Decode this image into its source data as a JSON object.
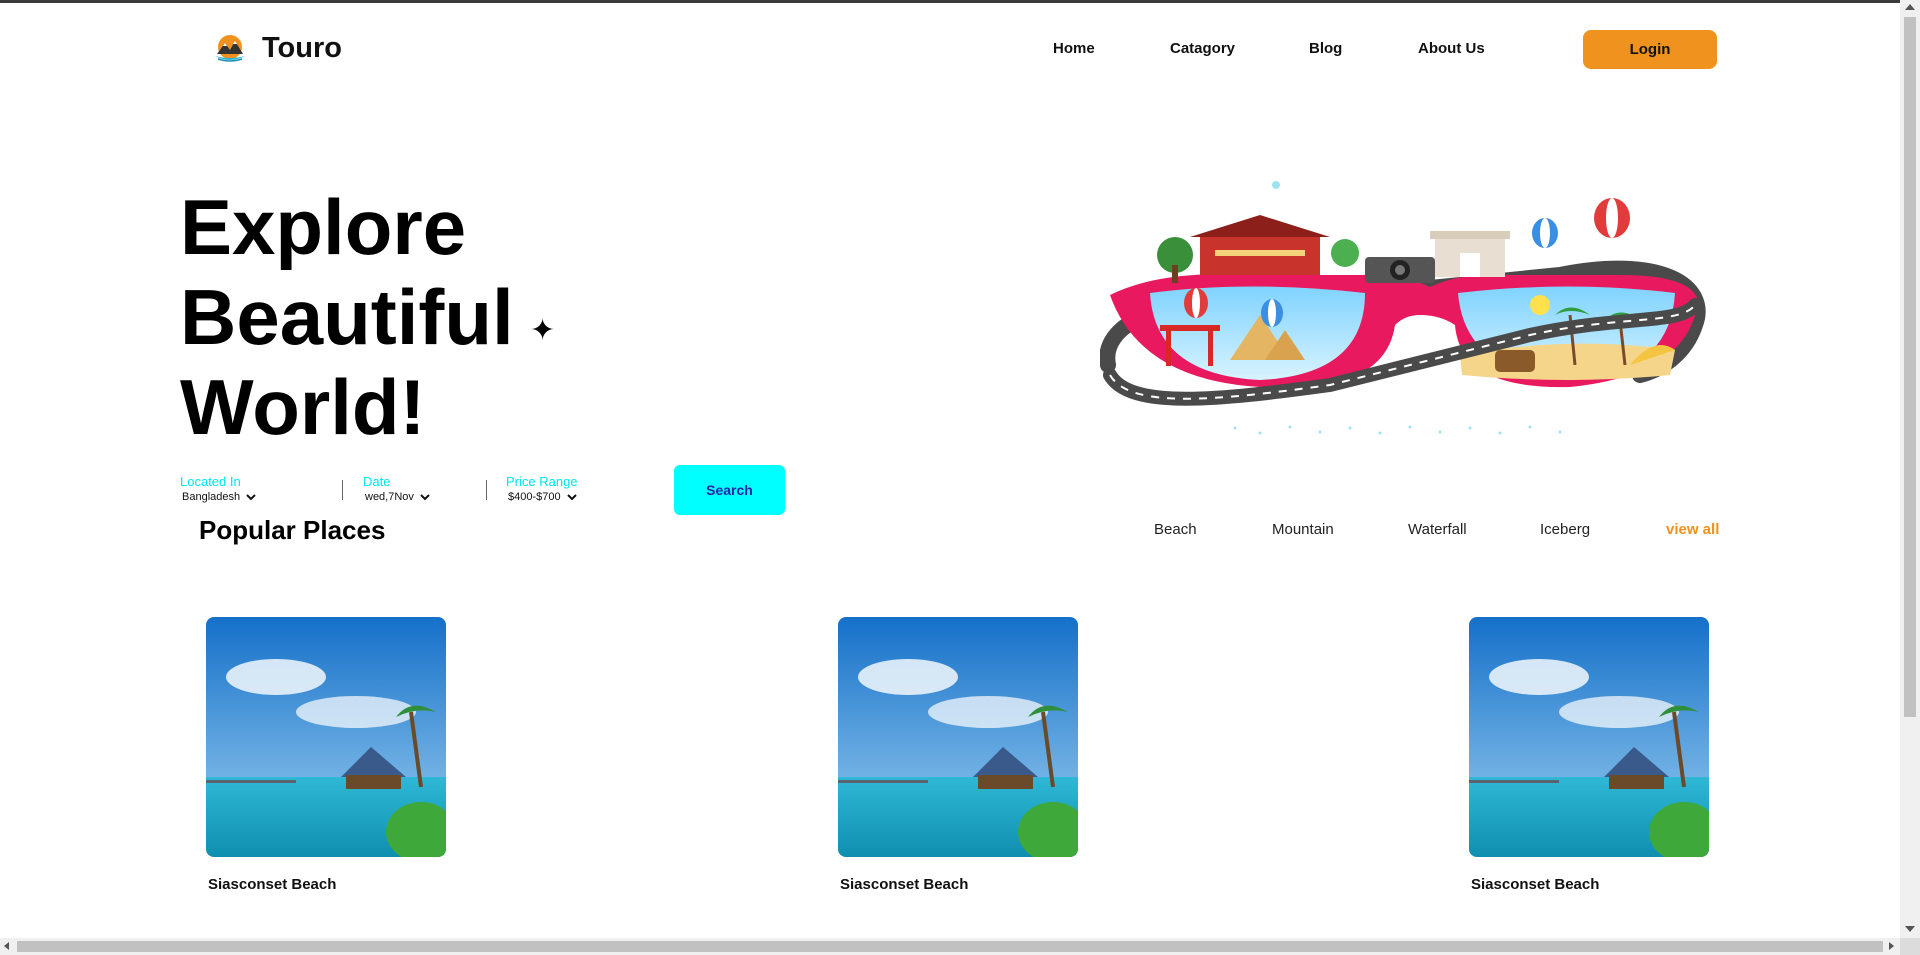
{
  "brand": {
    "name": "Touro",
    "accent": "#f0921e",
    "cyan": "#00ffff"
  },
  "nav": {
    "items": [
      {
        "label": "Home"
      },
      {
        "label": "Catagory"
      },
      {
        "label": "Blog"
      },
      {
        "label": "About Us"
      }
    ],
    "login_label": "Login"
  },
  "hero": {
    "lines": [
      "Explore",
      "Beautiful",
      "World!"
    ],
    "sparkle": "✦"
  },
  "search": {
    "location": {
      "label": "Located In",
      "value": "Bangladesh"
    },
    "date": {
      "label": "Date",
      "value": "wed,7Nov"
    },
    "price": {
      "label": "Price Range",
      "value": "$400-$700"
    },
    "button_label": "Search"
  },
  "popular": {
    "title": "Popular Places",
    "categories": [
      "Beach",
      "Mountain",
      "Waterfall",
      "Iceberg"
    ],
    "view_all_label": "view all",
    "cards": [
      {
        "title": "Siasconset Beach"
      },
      {
        "title": "Siasconset Beach"
      },
      {
        "title": "Siasconset Beach"
      }
    ]
  }
}
